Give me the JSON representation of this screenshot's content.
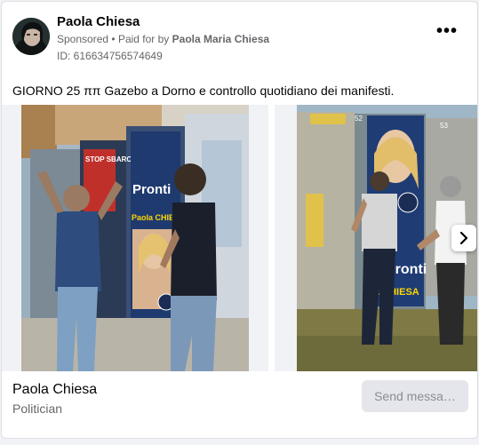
{
  "ad": {
    "advertiser_name": "Paola Chiesa",
    "sponsored_label": "Sponsored",
    "separator": "•",
    "paid_for_by_label": "Paid for by",
    "paid_for_by_name": "Paola Maria Chiesa",
    "id_text": "ID: 616634756574649",
    "more_options_glyph": "•••",
    "body_text": "GIORNO 25 ππ Gazebo a Dorno e controllo quotidiano dei manifesti."
  },
  "carousel": {
    "next_icon": "chevron-right-icon",
    "slides": [
      {
        "poster_top_text": "STOP SBARCHI",
        "poster_pronti": "Pronti",
        "poster_name": "Paola CHIESA"
      },
      {
        "board_number_left": "52",
        "board_number_right": "53",
        "poster_name": "a CHIESA",
        "poster_pronti": "Pronti"
      }
    ]
  },
  "footer": {
    "page_name": "Paola Chiesa",
    "page_category": "Politician",
    "send_button_label": "Send messa…"
  },
  "colors": {
    "primary_text": "#050505",
    "secondary_text": "#65676b",
    "button_bg": "#e4e6eb",
    "button_text": "#8a8d91"
  }
}
